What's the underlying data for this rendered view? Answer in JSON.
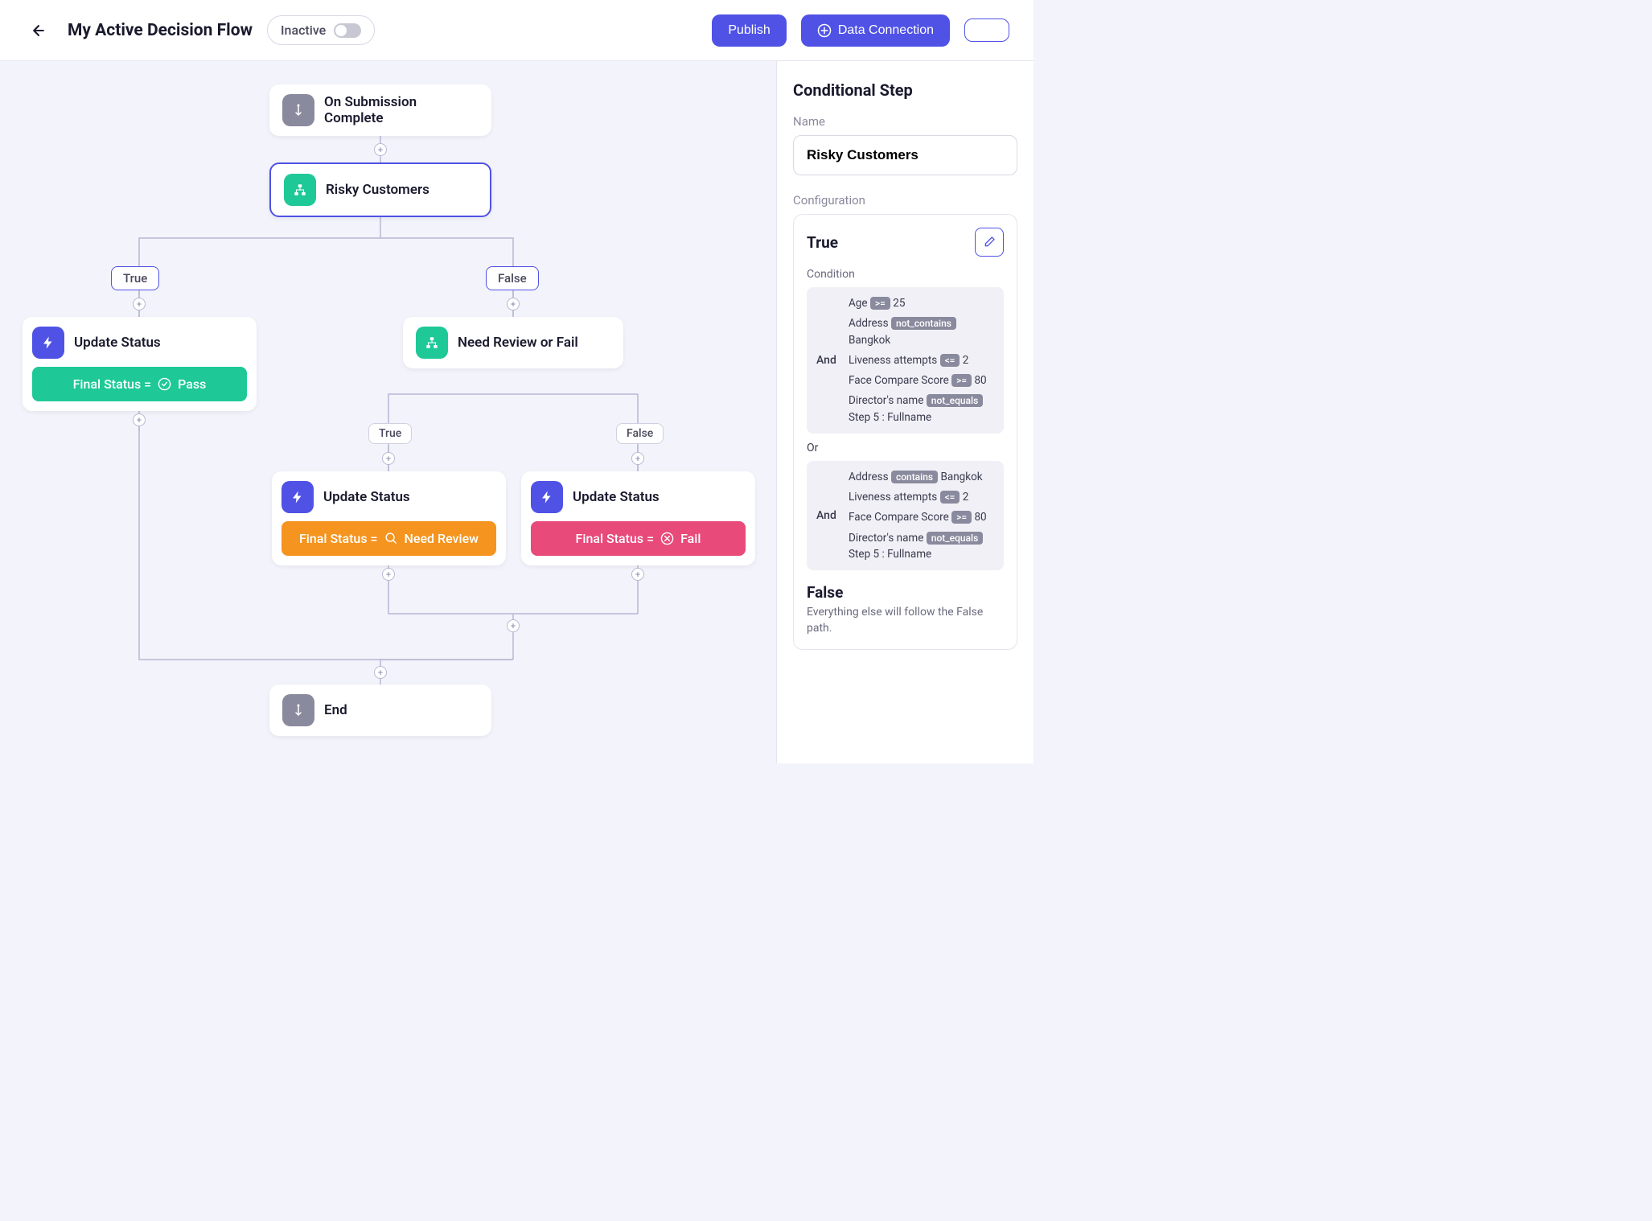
{
  "header": {
    "title": "My Active Decision Flow",
    "status": "Inactive",
    "publish": "Publish",
    "data_connection": "Data Connection"
  },
  "nodes": {
    "start": "On Submission Complete",
    "risky": "Risky Customers",
    "branch_true": "True",
    "branch_false": "False",
    "update_pass_title": "Update Status",
    "update_pass_status": "Final Status = ",
    "update_pass_value": "Pass",
    "need_review": "Need Review or Fail",
    "branch2_true": "True",
    "branch2_false": "False",
    "update_review_title": "Update Status",
    "update_review_status": "Final Status = ",
    "update_review_value": "Need Review",
    "update_fail_title": "Update Status",
    "update_fail_status": "Final Status = ",
    "update_fail_value": "Fail",
    "end": "End"
  },
  "sidebar": {
    "title": "Conditional Step",
    "name_label": "Name",
    "name_value": "Risky Customers",
    "config_label": "Configuration",
    "true_label": "True",
    "condition_label": "Condition",
    "and": "And",
    "or": "Or",
    "block1": {
      "l1_field": "Age",
      "l1_op": ">=",
      "l1_val": "25",
      "l2_field": "Address",
      "l2_op": "not_contains",
      "l2_val": "Bangkok",
      "l3_field": "Liveness attempts",
      "l3_op": "<=",
      "l3_val": "2",
      "l4_field": "Face Compare Score",
      "l4_op": ">=",
      "l4_val": "80",
      "l5_field": "Director's name",
      "l5_op": "not_equals",
      "l5_val": "Step 5 : Fullname"
    },
    "block2": {
      "l1_field": "Address",
      "l1_op": "contains",
      "l1_val": "Bangkok",
      "l2_field": "Liveness attempts",
      "l2_op": "<=",
      "l2_val": "2",
      "l3_field": "Face Compare Score",
      "l3_op": ">=",
      "l3_val": "80",
      "l4_field": "Director's name",
      "l4_op": "not_equals",
      "l4_val": "Step 5 : Fullname"
    },
    "false_label": "False",
    "false_desc": "Everything else will follow the False path."
  }
}
